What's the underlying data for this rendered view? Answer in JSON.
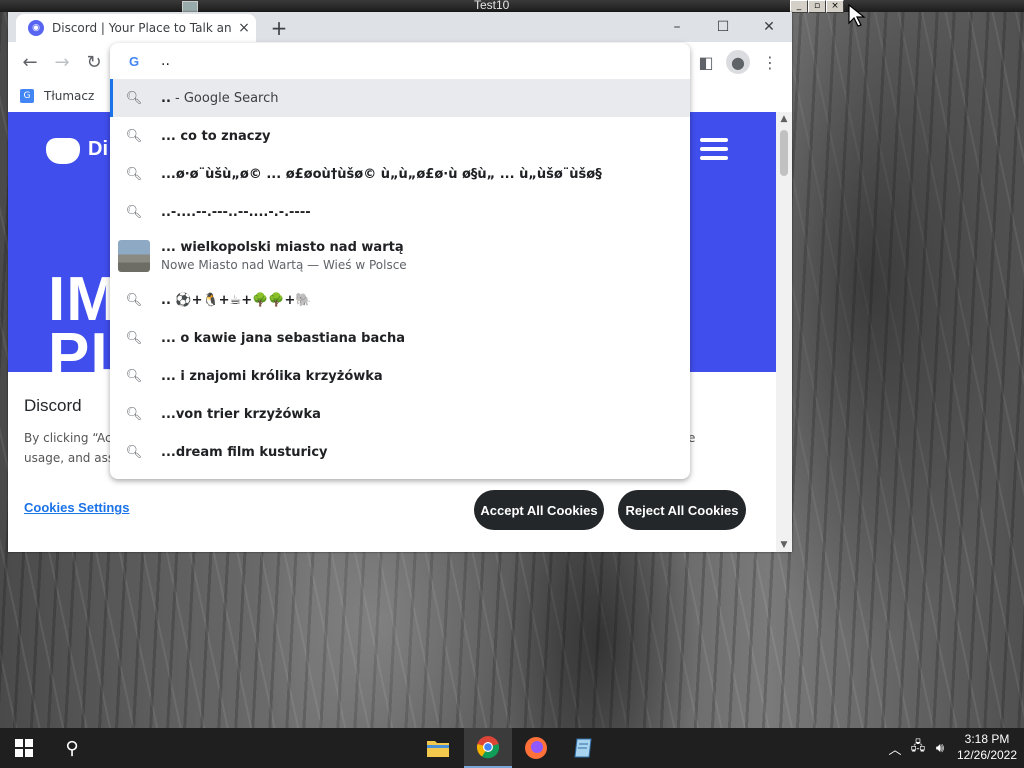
{
  "window": {
    "title": "Test10",
    "controls": [
      "_",
      "▫",
      "×"
    ]
  },
  "browser": {
    "tab": {
      "title": "Discord | Your Place to Talk and Hang Out",
      "close": "×"
    },
    "new_tab": "+",
    "omnibox_value": "..",
    "bookmarks": [
      {
        "label": "Tłumacz"
      }
    ]
  },
  "omnibox": {
    "suggestions": [
      {
        "text": ".. - Google Search",
        "type": "search",
        "bold_part": "..",
        "rest": " - Google Search"
      },
      {
        "text": "... co to znaczy",
        "type": "search"
      },
      {
        "text": "...ø·ø¨ùšù„ø© ... ø£øoù†ùšø© ù„ù„ø£ø·ù ø§ù„ ... ù„ùšø¨ùšø§",
        "type": "search"
      },
      {
        "text": "..-....--.---..--....-.-.----",
        "type": "search"
      },
      {
        "text": "... wielkopolski miasto nad wartą",
        "subtext": "Nowe Miasto nad Wartą — Wieś w Polsce",
        "type": "entity"
      },
      {
        "text": ".. ⚽+🐧+☕+🌳🌳+🐘",
        "type": "search"
      },
      {
        "text": "... o kawie jana sebastiana bacha",
        "type": "search"
      },
      {
        "text": "... i znajomi królika krzyżówka",
        "type": "search"
      },
      {
        "text": "...von trier krzyżówka",
        "type": "search"
      },
      {
        "text": "...dream film kusturicy",
        "type": "search"
      }
    ]
  },
  "page": {
    "brand_partial": "Di",
    "hero_text_line1": "IM",
    "hero_text_line2": "PL",
    "cookie_title": "Discord",
    "cookie_text_line1": "By clicking “Acc",
    "cookie_text_line2": "usage, and assis",
    "cookie_text_tail": "e",
    "cookies_settings": "Cookies Settings",
    "accept_all": "Accept All Cookies",
    "reject_all": "Reject All Cookies"
  },
  "taskbar": {
    "time": "3:18 PM",
    "date": "12/26/2022",
    "apps": [
      "file-explorer",
      "chrome",
      "firefox",
      "notepad"
    ]
  },
  "colors": {
    "discord_blurple": "#404eed",
    "chrome_blue": "#1a73e8",
    "taskbar": "#1f1f1f"
  }
}
